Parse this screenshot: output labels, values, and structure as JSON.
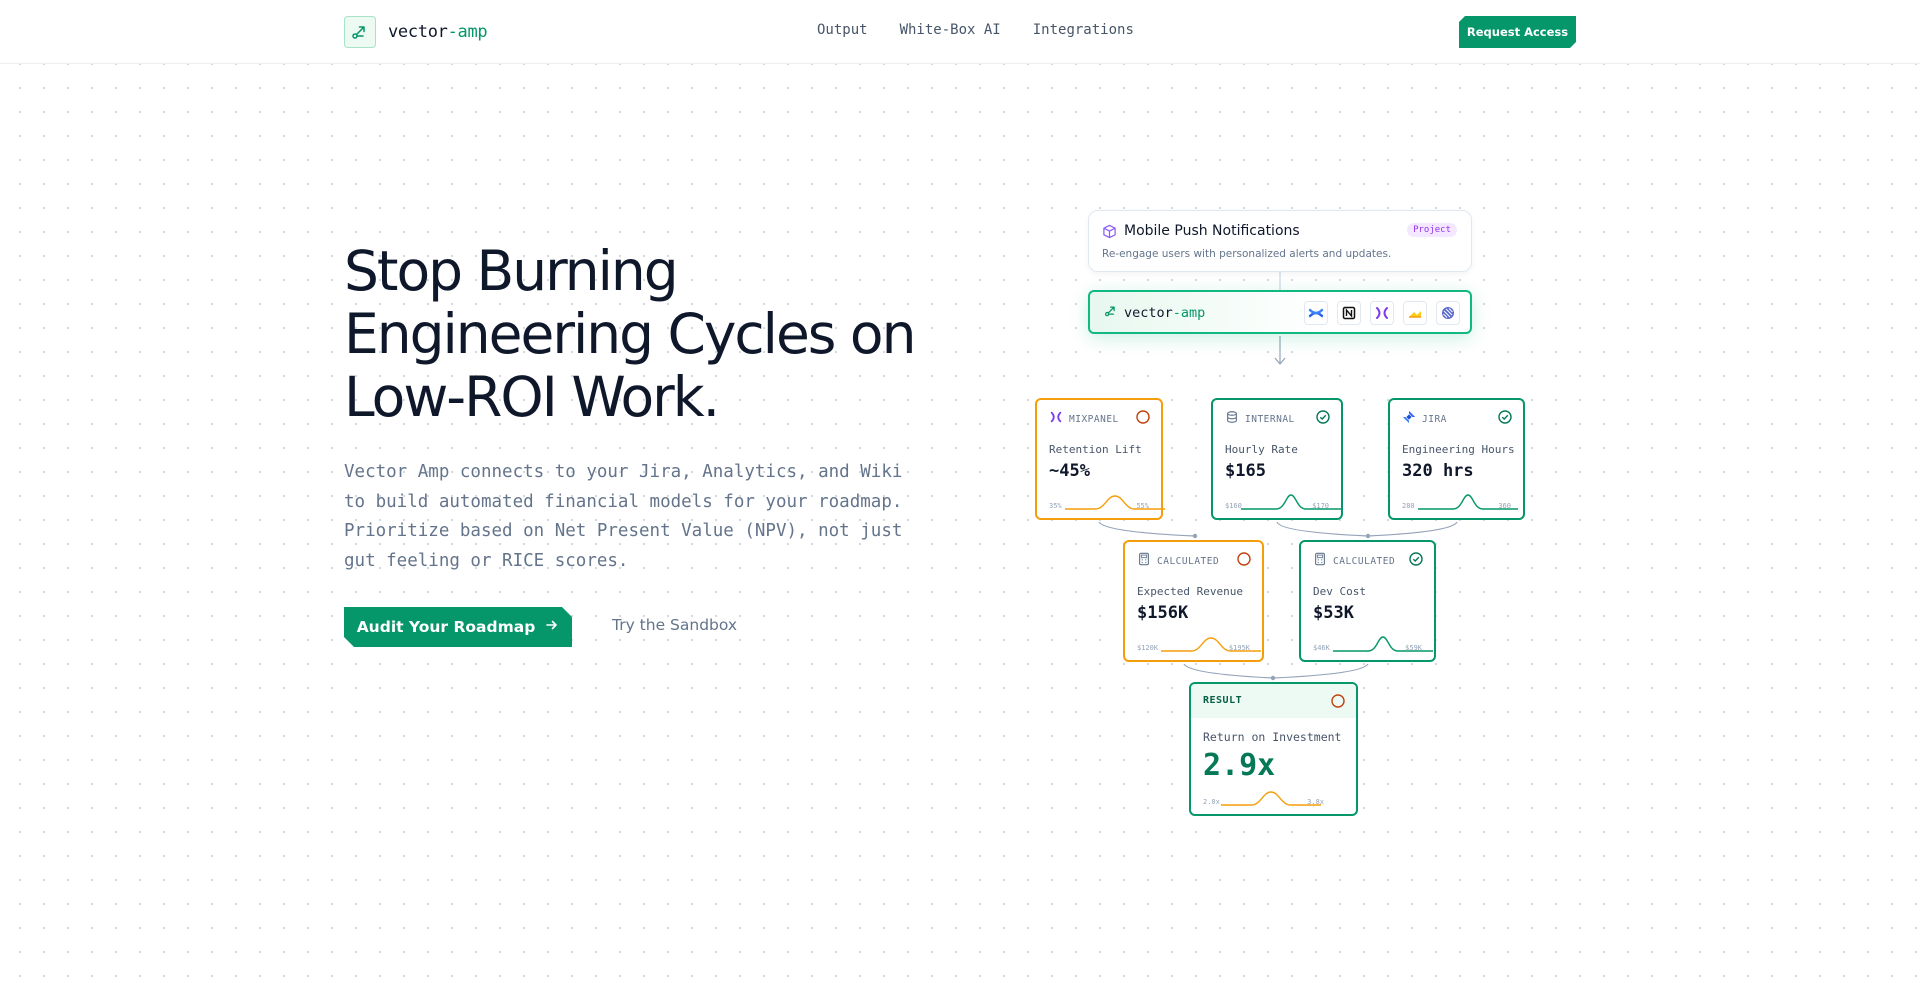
{
  "nav": {
    "logo_main": "vector",
    "logo_accent": "-amp",
    "links": [
      "Output",
      "White-Box AI",
      "Integrations"
    ],
    "cta": "Request Access"
  },
  "hero": {
    "title_lines": [
      "Stop Burning",
      "Engineering Cycles on",
      "Low-ROI Work."
    ],
    "subtitle_lines": [
      "Vector Amp connects to your Jira, Analytics, and Wiki",
      "to build automated financial models for your roadmap.",
      "Prioritize based on Net Present Value (NPV), not just",
      "gut feeling or RICE scores."
    ],
    "primary_button": "Audit Your Roadmap",
    "secondary_button": "Try the Sandbox"
  },
  "diagram": {
    "project": {
      "title": "Mobile Push Notifications",
      "badge": "Project",
      "description": "Re-engage users with personalized alerts and updates."
    },
    "engine": {
      "logo_main": "vector",
      "logo_accent": "-amp",
      "integrations": [
        "confluence-icon",
        "notion-icon",
        "mixpanel-icon",
        "analytics-icon",
        "linear-icon"
      ]
    },
    "inputs": [
      {
        "source": "MIXPANEL",
        "label": "Retention Lift",
        "value": "~45%",
        "low": "35%",
        "high": "55%",
        "status": "pending",
        "icon": "mixpanel-icon"
      },
      {
        "source": "INTERNAL",
        "label": "Hourly Rate",
        "value": "$165",
        "low": "$160",
        "high": "$170",
        "status": "verified",
        "icon": "database-icon"
      },
      {
        "source": "JIRA",
        "label": "Engineering Hours",
        "value": "320 hrs",
        "low": "280",
        "high": "360",
        "status": "verified",
        "icon": "jira-icon"
      }
    ],
    "calculated": [
      {
        "source": "CALCULATED",
        "label": "Expected Revenue",
        "value": "$156K",
        "low": "$120K",
        "high": "$195K",
        "status": "pending",
        "icon": "calculator-icon"
      },
      {
        "source": "CALCULATED",
        "label": "Dev Cost",
        "value": "$53K",
        "low": "$46K",
        "high": "$59K",
        "status": "verified",
        "icon": "calculator-icon"
      }
    ],
    "result": {
      "title": "RESULT",
      "label": "Return on Investment",
      "value": "2.9x",
      "low": "2.0x",
      "high": "3.8x",
      "status": "pending"
    }
  },
  "colors": {
    "brand": "#059669",
    "pending": "#f59e0b",
    "text": "#0f172a",
    "muted": "#64748b"
  }
}
